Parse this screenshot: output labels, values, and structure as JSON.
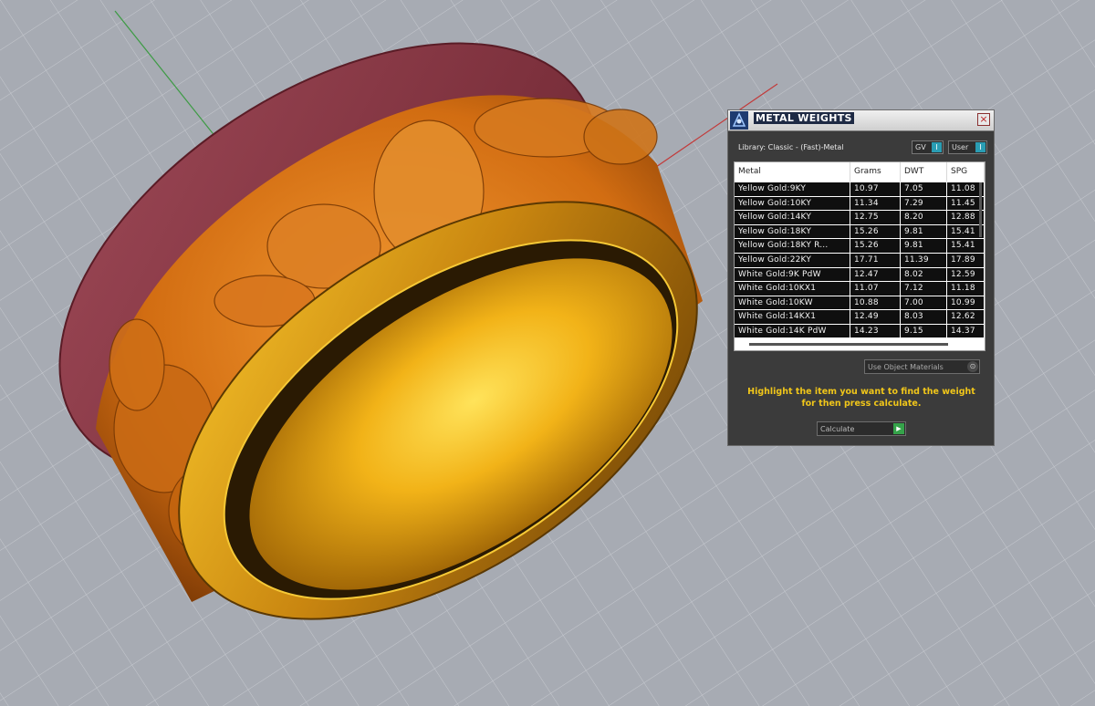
{
  "dialog": {
    "title": "METAL WEIGHTS",
    "close_glyph": "×",
    "library_label": "Library: Classic - (Fast)-Metal",
    "gv_button": "GV",
    "user_button": "User",
    "toggle_glyph": "I"
  },
  "table": {
    "columns": [
      "Metal",
      "Grams",
      "DWT",
      "SPG"
    ],
    "rows": [
      [
        "Yellow Gold:9KY",
        "10.97",
        "7.05",
        "11.08"
      ],
      [
        "Yellow Gold:10KY",
        "11.34",
        "7.29",
        "11.45"
      ],
      [
        "Yellow Gold:14KY",
        "12.75",
        "8.20",
        "12.88"
      ],
      [
        "Yellow Gold:18KY",
        "15.26",
        "9.81",
        "15.41"
      ],
      [
        "Yellow Gold:18KY R...",
        "15.26",
        "9.81",
        "15.41"
      ],
      [
        "Yellow Gold:22KY",
        "17.71",
        "11.39",
        "17.89"
      ],
      [
        "White Gold:9K PdW",
        "12.47",
        "8.02",
        "12.59"
      ],
      [
        "White Gold:10KX1",
        "11.07",
        "7.12",
        "11.18"
      ],
      [
        "White Gold:10KW",
        "10.88",
        "7.00",
        "10.99"
      ],
      [
        "White Gold:14KX1",
        "12.49",
        "8.03",
        "12.62"
      ],
      [
        "White Gold:14K PdW",
        "14.23",
        "9.15",
        "14.37"
      ]
    ]
  },
  "materials_dropdown": {
    "selected": "Use Object Materials",
    "dropdown_glyph": "⊙"
  },
  "instruction": "Highlight the item you want to find the weight for then press calculate.",
  "calculate_button": {
    "label": "Calculate",
    "go_glyph": "▶"
  },
  "icons": {
    "app": "rhino-app-icon",
    "close": "close-icon"
  },
  "colors": {
    "viewport_bg": "#a7abb3",
    "panel_bg": "#3b3b3b",
    "instruction_text": "#f0c61a",
    "ring_gold": "#d79a14",
    "ring_rim": "#8f3a45",
    "toggle_accent": "#2a9db3"
  }
}
